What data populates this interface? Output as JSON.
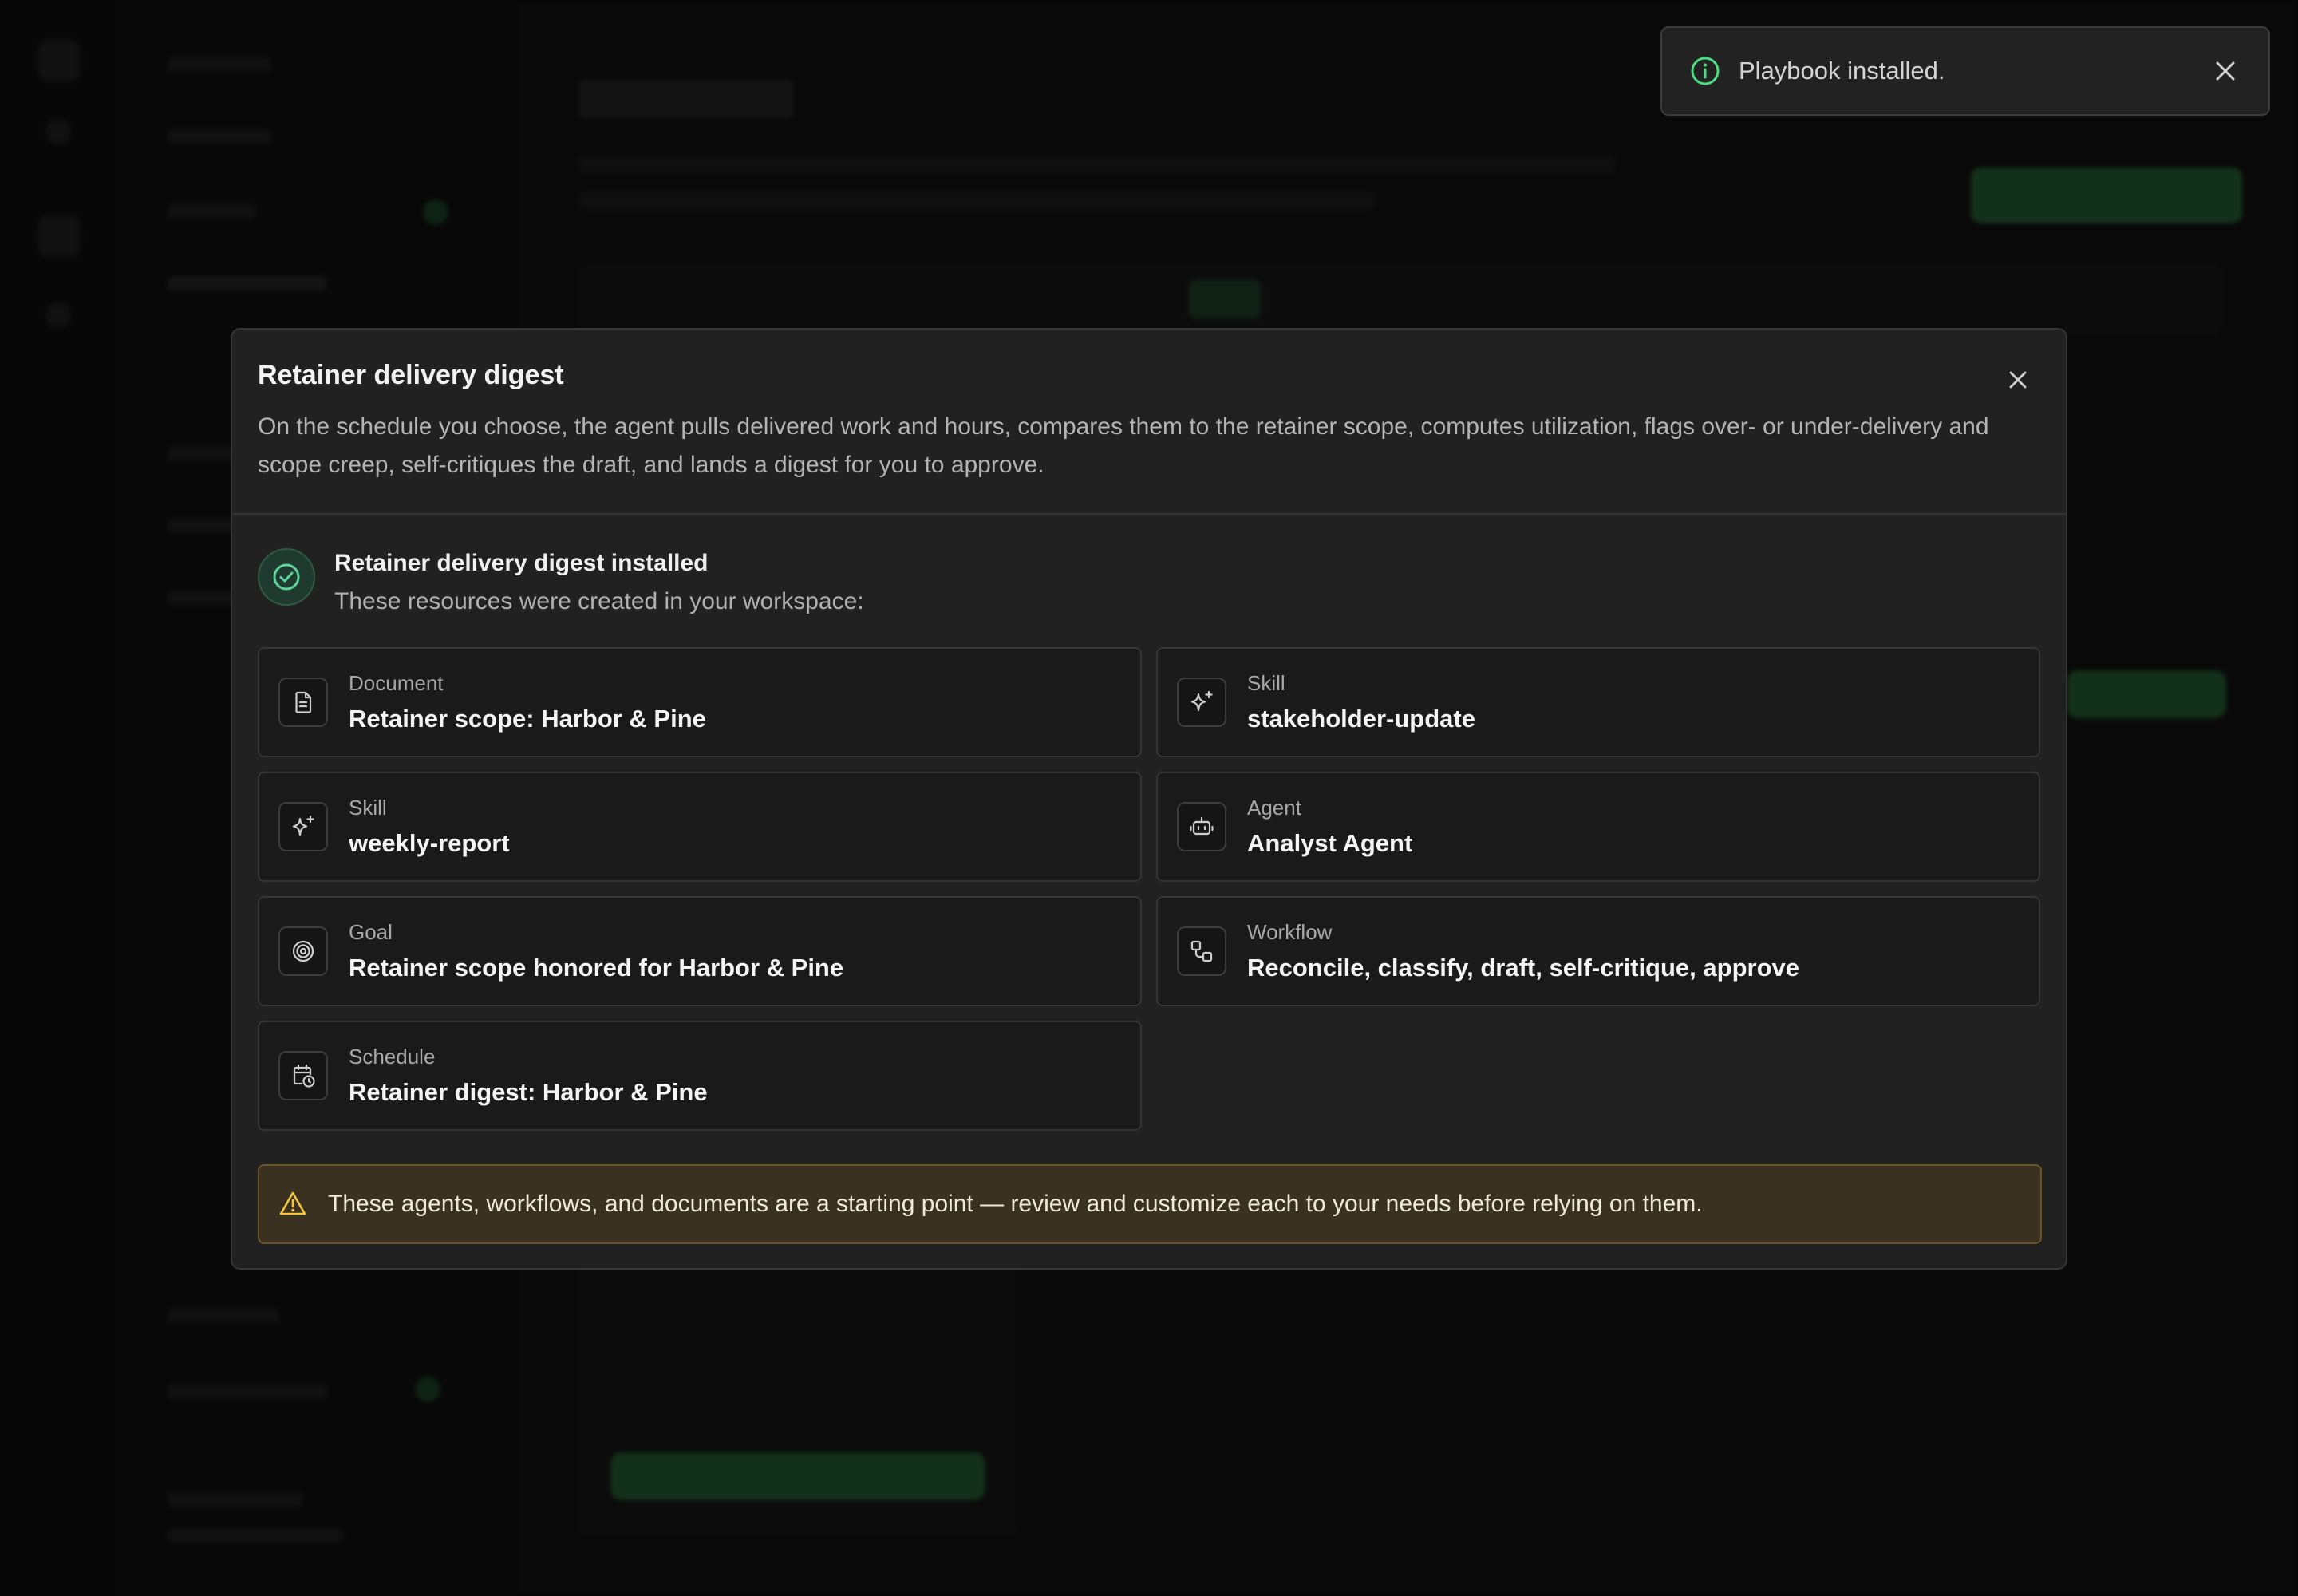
{
  "toast": {
    "message": "Playbook installed.",
    "icon": "info-icon",
    "close_icon": "close-icon",
    "accent": "#4ade80"
  },
  "modal": {
    "title": "Retainer delivery digest",
    "description": "On the schedule you choose, the agent pulls delivered work and hours, compares them to the retainer scope, computes utilization, flags over- or under-delivery and scope creep, self-critiques the draft, and lands a digest for you to approve.",
    "success": {
      "title": "Retainer delivery digest installed",
      "subtitle": "These resources were created in your workspace:"
    },
    "resources": [
      {
        "type": "Document",
        "name": "Retainer scope: Harbor & Pine",
        "icon": "document-icon"
      },
      {
        "type": "Skill",
        "name": "stakeholder-update",
        "icon": "sparkle-icon"
      },
      {
        "type": "Skill",
        "name": "weekly-report",
        "icon": "sparkle-icon"
      },
      {
        "type": "Agent",
        "name": "Analyst Agent",
        "icon": "robot-icon"
      },
      {
        "type": "Goal",
        "name": "Retainer scope honored for Harbor & Pine",
        "icon": "target-icon"
      },
      {
        "type": "Workflow",
        "name": "Reconcile, classify, draft, self-critique, approve",
        "icon": "workflow-icon"
      },
      {
        "type": "Schedule",
        "name": "Retainer digest: Harbor & Pine",
        "icon": "calendar-clock-icon"
      }
    ],
    "warning": "These agents, workflows, and documents are a starting point — review and customize each to your needs before relying on them.",
    "colors": {
      "success": "#5fd39a",
      "warning": "#f5c542",
      "warning_bg": "#3a3120"
    }
  }
}
